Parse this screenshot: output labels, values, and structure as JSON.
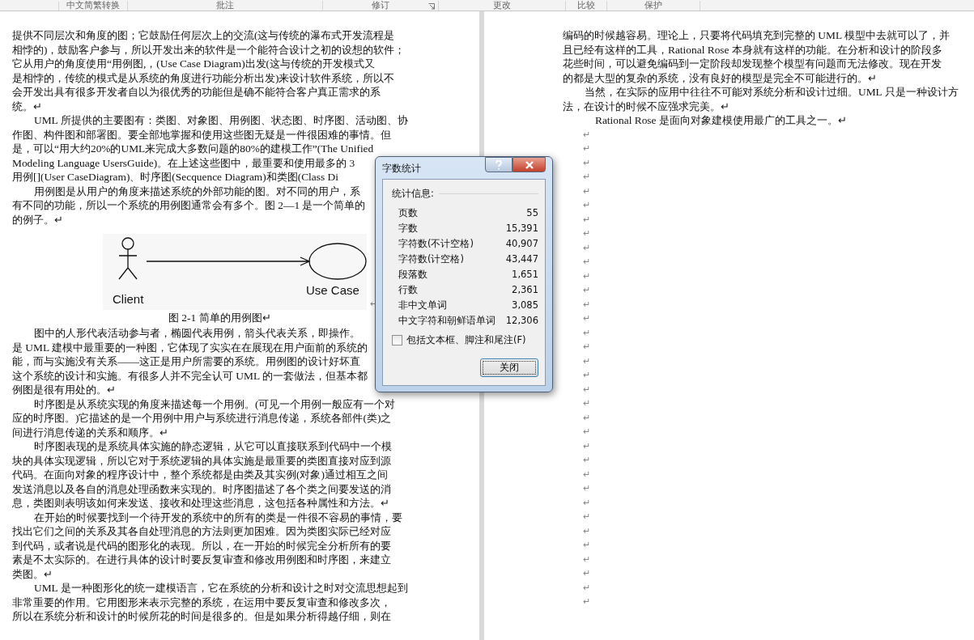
{
  "ribbon": {
    "groups": [
      {
        "label": "中文简繁转换",
        "launcher": false
      },
      {
        "label": "批注",
        "launcher": false
      },
      {
        "label": "修订",
        "launcher": true
      },
      {
        "label": "更改",
        "launcher": false
      },
      {
        "label": "比较",
        "launcher": false
      },
      {
        "label": "保护",
        "launcher": false
      }
    ]
  },
  "left_page": {
    "blocks": [
      {
        "kind": "paragraph",
        "lines": [
          "提供不同层次和角度的图；它鼓励任何层次上的交流(这与传统的瀑布式开发流程是",
          "相悖的)，鼓励客户参与，所以开发出来的软件是一个能符合设计之初的设想的软件；",
          "它从用户的角度使用“用例图,，(Use Case Diagram)出发(这与传统的开发模式又",
          "是相悖的，传统的模式是从系统的角度进行功能分析出发)来设计软件系统，所以不",
          "会开发出具有很多开发者自以为很优秀的功能但是确不能符合客户真正需求的系",
          "统。↵"
        ]
      },
      {
        "kind": "indented_paragraph",
        "lines": [
          "UML 所提供的主要图有：类图、对象图、用例图、状态图、时序图、活动图、协",
          "作图、构件图和部署图。要全部地掌握和使用这些图无疑是一件很困难的事情。但",
          "是，可以“用大约20%的UML来完成大多数问题的80%的建模工作”(The Unified",
          "Modeling Language UsersGuide)。在上述这些图中，最重要和使用最多的 3",
          "用例[](User CaseDiagram)、时序图(Secquence Diagram)和类图(Class Di"
        ]
      },
      {
        "kind": "indented_paragraph",
        "lines": [
          "用例图是从用户的角度来描述系统的外部功能的图。对不同的用户，系",
          "有不同的功能，所以一个系统的用例图通常会有多个。图 2—1 是一个简单的",
          "的例子。↵"
        ]
      },
      {
        "kind": "figure",
        "actor_label": "Client",
        "usecase_label": "Use Case",
        "end_mark": "↵"
      },
      {
        "kind": "caption",
        "text": "图 2-1  简单的用例图↵"
      },
      {
        "kind": "indented_paragraph",
        "lines": [
          "图中的人形代表活动参与者，椭圆代表用例，箭头代表关系，即操作。",
          "是 UML 建模中最重要的一种图，它体现了实实在在展现在用户面前的系统的",
          "能，而与实施没有关系——这正是用户所需要的系统。用例图的设计好坏直",
          "这个系统的设计和实施。有很多人并不完全认可 UML 的一套做法，但基本都",
          "例图是很有用处的。↵"
        ]
      },
      {
        "kind": "indented_paragraph",
        "lines": [
          "时序图是从系统实现的角度来描述每一个用例。(可见一个用例一般应有一个对",
          "应的时序图。)它描述的是一个用例中用户与系统进行消息传递，系统各部件(类)之",
          "间进行消息传递的关系和顺序。↵"
        ]
      },
      {
        "kind": "indented_paragraph",
        "lines": [
          "时序图表现的是系统具体实施的静态逻辑，从它可以直接联系到代码中一个模",
          "块的具体实现逻辑，所以它对于系统逻辑的具体实施是最重要的类图直接对应到源",
          "代码。在面向对象的程序设计中，整个系统都是由类及其实例(对象)通过相互之间",
          "发送消息以及各自的消息处理函数来实现的。时序图描述了各个类之间要发送的消",
          "息，类图则表明该如何来发送、接收和处理这些消息，这包括各种属性和方法。↵"
        ]
      },
      {
        "kind": "indented_paragraph",
        "lines": [
          "在开始的时候要找到一个待开发的系统中的所有的类是一件很不容易的事情，要",
          "找出它们之间的关系及其各自处理消息的方法则更加困难。因为类图实际已经对应",
          "到代码，或者说是代码的图形化的表现。所以，在一开始的时候完全分析所有的要",
          "素是不太实际的。在进行具体的设计时要反复审查和修改用例图和时序图，来建立",
          "类图。↵"
        ]
      },
      {
        "kind": "indented_paragraph",
        "lines": [
          "UML 是一种图形化的统一建模语言，它在系统的分析和设计之时对交流思想起到",
          "非常重要的作用。它用图形来表示完整的系统，在运用中要反复审查和修改多次，",
          "所以在系统分析和设计的时候所花的时间是很多的。但是如果分析得越仔细，则在"
        ]
      }
    ]
  },
  "right_page": {
    "blocks": [
      {
        "kind": "paragraph",
        "lines": [
          "编码的时候越容易。理论上，只要将代码填充到完整的 UML 模型中去就可以了，并",
          "且已经有这样的工具，Rational Rose 本身就有这样的功能。在分析和设计的阶段多",
          "花些时间，可以避免编码到一定阶段却发现整个模型有问题而无法修改。现在开发",
          "的都是大型的复杂的系统，没有良好的模型是完全不可能进行的。↵"
        ]
      },
      {
        "kind": "indented_paragraph",
        "lines": [
          "当然，在实际的应用中往往不可能对系统分析和设计过细。UML 只是一种设计方",
          "法，在设计的时候不应强求完美。↵"
        ]
      },
      {
        "kind": "deep_indented_paragraph",
        "lines": [
          "Rational Rose 是面向对象建模使用最广的工具之一。↵"
        ]
      }
    ],
    "empty_marks": [
      "↵",
      "↵",
      "↵",
      "↵",
      "↵",
      "↵",
      "↵",
      "↵",
      "↵",
      "↵",
      "↵",
      "↵",
      "↵",
      "↵",
      "↵",
      "↵",
      "↵",
      "↵",
      "↵",
      "↵",
      "↵",
      "↵",
      "↵",
      "↵",
      "↵",
      "↵",
      "↵",
      "↵",
      "↵",
      "↵",
      "↵",
      "↵",
      "↵",
      "↵"
    ]
  },
  "dialog": {
    "title": "字数统计",
    "section": "统计信息:",
    "stats": [
      {
        "label": "页数",
        "value": "55"
      },
      {
        "label": "字数",
        "value": "15,391"
      },
      {
        "label": "字符数(不计空格)",
        "value": "40,907"
      },
      {
        "label": "字符数(计空格)",
        "value": "43,447"
      },
      {
        "label": "段落数",
        "value": "1,651"
      },
      {
        "label": "行数",
        "value": "2,361"
      },
      {
        "label": "非中文单词",
        "value": "3,085"
      },
      {
        "label": "中文字符和朝鲜语单词",
        "value": "12,306"
      }
    ],
    "checkbox": {
      "label": "包括文本框、脚注和尾注(F)",
      "checked": false
    },
    "button": "关闭"
  }
}
